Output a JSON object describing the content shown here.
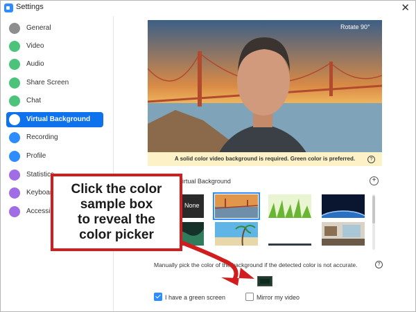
{
  "window": {
    "title": "Settings",
    "close_glyph": "✕"
  },
  "sidebar": {
    "items": [
      {
        "label": "General",
        "icon": "gear-icon",
        "color": "#8e8e8e"
      },
      {
        "label": "Video",
        "icon": "video-camera-icon",
        "color": "#4bc37b"
      },
      {
        "label": "Audio",
        "icon": "headphones-icon",
        "color": "#4bc37b"
      },
      {
        "label": "Share Screen",
        "icon": "share-screen-icon",
        "color": "#4bc37b"
      },
      {
        "label": "Chat",
        "icon": "chat-bubble-icon",
        "color": "#4bc37b"
      },
      {
        "label": "Virtual Background",
        "icon": "person-background-icon",
        "color": "#0e72ed",
        "active": true
      },
      {
        "label": "Recording",
        "icon": "record-icon",
        "color": "#2d8cff"
      },
      {
        "label": "Profile",
        "icon": "profile-icon",
        "color": "#2d8cff"
      },
      {
        "label": "Statistics",
        "icon": "statistics-icon",
        "color": "#a06de6"
      },
      {
        "label": "Keyboard Shortcuts",
        "icon": "keyboard-icon",
        "color": "#a06de6"
      },
      {
        "label": "Accessibility",
        "icon": "accessibility-icon",
        "color": "#a06de6"
      }
    ]
  },
  "preview": {
    "rotate_label": "Rotate 90°",
    "notice": "A solid color video background is required. Green color is preferred.",
    "help_glyph": "?"
  },
  "virtual_background": {
    "heading": "Virtual Background",
    "add_glyph": "+",
    "thumbnails": [
      {
        "name": "none",
        "label": "None"
      },
      {
        "name": "golden-gate-bridge",
        "selected": true
      },
      {
        "name": "grass"
      },
      {
        "name": "earth-from-space"
      },
      {
        "name": "aurora"
      },
      {
        "name": "beach-palm-tree"
      },
      {
        "name": "blank"
      },
      {
        "name": "office-room"
      }
    ]
  },
  "manual_pick": {
    "text": "Manually pick the color of the background if the detected color is not accurate.",
    "help_glyph": "?",
    "swatch_color": "#1d3a2e"
  },
  "options": {
    "green_screen": {
      "label": "I have a green screen",
      "checked": true
    },
    "mirror": {
      "label": "Mirror my video",
      "checked": false
    }
  },
  "callout": {
    "lines": [
      "Click the color",
      "sample box",
      "to reveal the",
      "color picker"
    ],
    "border_color": "#d11d1d"
  }
}
